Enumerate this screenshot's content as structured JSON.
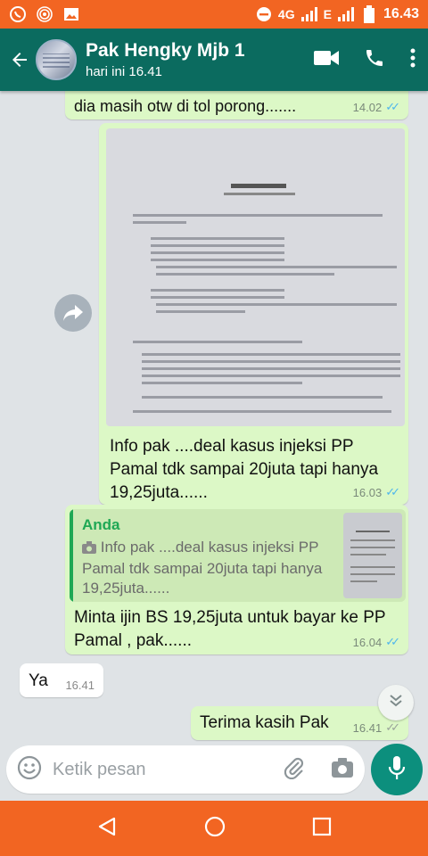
{
  "status_bar": {
    "network_label": "4G",
    "signal2_label": "E",
    "time": "16.43",
    "left_icons": [
      "whatsapp-icon",
      "hotspot-icon",
      "image-icon"
    ],
    "right_icons": [
      "dnd-icon",
      "signal-icon",
      "signal-icon",
      "battery-icon"
    ]
  },
  "header": {
    "contact_name": "Pak Hengky Mjb 1",
    "last_seen": "hari ini 16.41",
    "icons": [
      "back-arrow-icon",
      "video-call-icon",
      "phone-icon",
      "more-vert-icon"
    ]
  },
  "messages": [
    {
      "direction": "out",
      "text": "dia masih otw di tol porong.......",
      "time": "14.02",
      "read": true
    },
    {
      "direction": "out",
      "type": "image",
      "caption": "Info pak ....deal kasus injeksi PP Pamal tdk sampai 20juta tapi hanya 19,25juta......",
      "time": "16.03",
      "read": true
    },
    {
      "direction": "out",
      "type": "reply",
      "quote_author": "Anda",
      "quote_text": "Info pak ....deal kasus injeksi PP Pamal tdk sampai 20juta tapi hanya 19,25juta......",
      "text": "Minta ijin BS 19,25juta untuk bayar ke PP Pamal , pak......",
      "time": "16.04",
      "read": true
    },
    {
      "direction": "in",
      "text": "Ya",
      "time": "16.41"
    },
    {
      "direction": "out",
      "text": "Terima kasih Pak",
      "time": "16.41",
      "read": false
    }
  ],
  "composer": {
    "placeholder": "Ketik pesan",
    "icons": [
      "emoji-icon",
      "attach-icon",
      "camera-icon",
      "mic-icon"
    ]
  },
  "colors": {
    "status_bar": "#f26522",
    "header": "#0b6b5f",
    "outgoing_bubble": "#dcf8c6",
    "incoming_bubble": "#ffffff",
    "chat_background": "#dfe3e6",
    "mic_button": "#0c8f7d",
    "read_ticks": "#4fb6ec"
  }
}
